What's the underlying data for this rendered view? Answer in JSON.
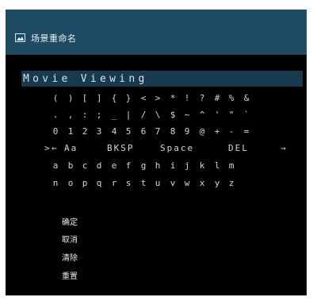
{
  "title": {
    "text": "场景重命名",
    "icon": "scene-image-icon"
  },
  "name_field": {
    "value": "Movie Viewing"
  },
  "keyboard": {
    "rows": [
      [
        "(",
        ")",
        "[",
        "]",
        "{",
        "}",
        "<",
        ">",
        "*",
        "!",
        "?",
        "#",
        "%",
        "&"
      ],
      [
        ".",
        ",",
        ":",
        ";",
        "_",
        "|",
        "/",
        "\\",
        "$",
        "~",
        "^",
        "'",
        "\"",
        "`"
      ],
      [
        "0",
        "1",
        "2",
        "3",
        "4",
        "5",
        "6",
        "7",
        "8",
        "9",
        "@",
        "+",
        "-",
        "="
      ],
      [
        "a",
        "b",
        "c",
        "d",
        "e",
        "f",
        "g",
        "h",
        "i",
        "j",
        "k",
        "l",
        "m"
      ],
      [
        "n",
        "o",
        "p",
        "q",
        "r",
        "s",
        "t",
        "u",
        "v",
        "w",
        "x",
        "y",
        "z"
      ]
    ],
    "commands": {
      "cursor_arrow": ">",
      "left_arrow": "←",
      "case_toggle": "Aa",
      "backspace": "BKSP",
      "space": "Space",
      "delete": "DEL",
      "right_arrow": "→"
    }
  },
  "menu": {
    "confirm": "确定",
    "cancel": "取消",
    "clear": "清除",
    "reset": "重置"
  }
}
